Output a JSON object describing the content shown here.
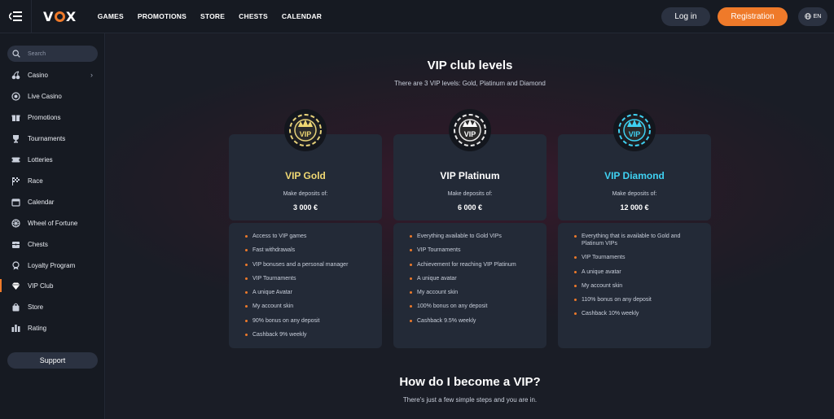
{
  "header": {
    "logo_left": "V",
    "logo_right": "X",
    "nav": [
      "GAMES",
      "PROMOTIONS",
      "STORE",
      "CHESTS",
      "CALENDAR"
    ],
    "login_label": "Log in",
    "register_label": "Registration",
    "lang": "EN"
  },
  "sidebar": {
    "search_placeholder": "Search",
    "items": [
      {
        "label": "Casino",
        "icon": "cherries-icon"
      },
      {
        "label": "Live Casino",
        "icon": "live-icon"
      },
      {
        "label": "Promotions",
        "icon": "gift-icon"
      },
      {
        "label": "Tournaments",
        "icon": "trophy-icon"
      },
      {
        "label": "Lotteries",
        "icon": "ticket-icon"
      },
      {
        "label": "Race",
        "icon": "flag-icon"
      },
      {
        "label": "Calendar",
        "icon": "calendar-icon"
      },
      {
        "label": "Wheel of Fortune",
        "icon": "wheel-icon"
      },
      {
        "label": "Chests",
        "icon": "chest-icon"
      },
      {
        "label": "Loyalty Program",
        "icon": "medal-icon"
      },
      {
        "label": "VIP Club",
        "icon": "diamond-icon"
      },
      {
        "label": "Store",
        "icon": "bag-icon"
      },
      {
        "label": "Rating",
        "icon": "rating-icon"
      }
    ],
    "active_item": "VIP Club",
    "support_label": "Support"
  },
  "main": {
    "title": "VIP club levels",
    "subtitle": "There are 3 VIP levels: Gold, Platinum and Diamond",
    "cards": [
      {
        "name": "VIP Gold",
        "color": "#f0d873",
        "deposit_label": "Make deposits of:",
        "amount": "3 000 €",
        "perks": [
          "Access to VIP games",
          "Fast withdrawals",
          "VIP bonuses and a personal manager",
          "VIP Tournaments",
          "A unique Avatar",
          "My account skin",
          "90% bonus on any deposit",
          "Cashback 9% weekly"
        ]
      },
      {
        "name": "VIP Platinum",
        "color": "#ffffff",
        "deposit_label": "Make deposits of:",
        "amount": "6 000 €",
        "perks": [
          "Everything available to Gold VIPs",
          "VIP Tournaments",
          "Achievement for reaching VIP Platinum",
          "A unique avatar",
          "My account skin",
          "100% bonus on any deposit",
          "Cashback 9.5% weekly"
        ]
      },
      {
        "name": "VIP Diamond",
        "color": "#3fd1f2",
        "deposit_label": "Make deposits of:",
        "amount": "12 000 €",
        "perks": [
          "Everything that is available to Gold and Platinum VIPs",
          "VIP Tournaments",
          "A unique avatar",
          "My account skin",
          "110% bonus on any deposit",
          "Cashback 10% weekly"
        ]
      }
    ],
    "badge_text": "VIP",
    "how_title": "How do I become a VIP?",
    "how_subtitle": "There's just a few simple steps and you are in."
  }
}
